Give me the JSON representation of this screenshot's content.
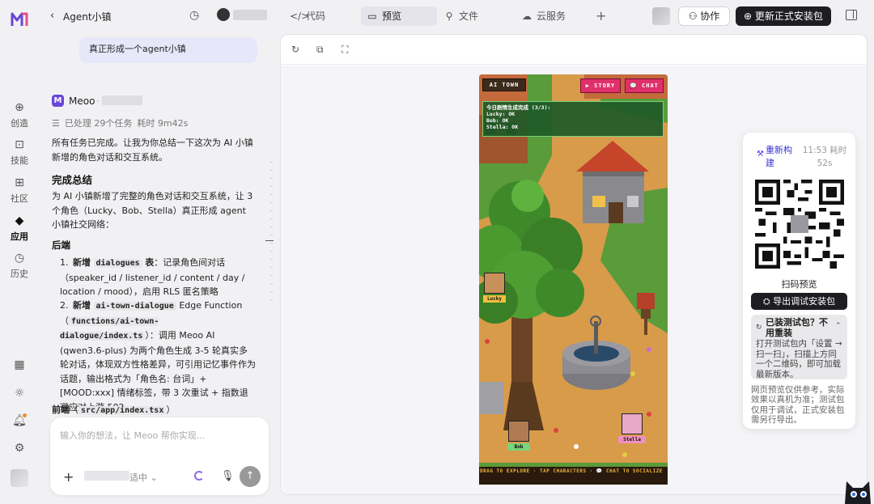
{
  "sidebar": {
    "items": [
      {
        "label": "创造",
        "icon": "plus-circle-icon"
      },
      {
        "label": "技能",
        "icon": "skill-icon"
      },
      {
        "label": "社区",
        "icon": "grid-icon"
      },
      {
        "label": "应用",
        "icon": "cube-icon"
      },
      {
        "label": "历史",
        "icon": "clock-icon"
      }
    ]
  },
  "header": {
    "project_title": "Agent小镇",
    "tabs": [
      {
        "label": "代码",
        "icon": "</>"
      },
      {
        "label": "预览",
        "icon": "▭"
      },
      {
        "label": "文件",
        "icon": "⚲"
      },
      {
        "label": "云服务",
        "icon": "☁"
      }
    ],
    "collab_label": "协作",
    "update_label": "更新正式安装包"
  },
  "chat": {
    "user_message": "真正形成一个agent小镇",
    "assistant_name": "Meoo",
    "task_processed": "已处理 29个任务",
    "task_time": "耗时 9m42s",
    "intro": "所有任务已完成。让我为你总结一下这次为 AI 小镇新增的角色对话和交互系统。",
    "summary_heading": "完成总结",
    "summary_text": "为 AI 小镇新增了完整的角色对话和交互系统，让 3 个角色（Lucky、Bob、Stella）真正形成 agent 小镇社交网络：",
    "backend_heading": "后端",
    "item1_num": "1.",
    "item1_prefix": "新增",
    "item1_code": "dialogues",
    "item1_suffix": "表",
    "item1_desc": "：记录角色间对话（speaker_id / listener_id / content / day / location / mood），启用 RLS 匿名策略",
    "item2_num": "2.",
    "item2_prefix": "新增",
    "item2_code": "ai-town-dialogue",
    "item2_suffix": " Edge Function",
    "item2_path": "functions/ai-town-dialogue/index.ts",
    "item2_desc": "：调用 Meoo AI (qwen3.6-plus) 为两个角色生成 3-5 轮真实多轮对话，体现双方性格差异，可引用记忆事件作为话题，输出格式为「角色名: 台词」+ [MOOD:xxx] 情绪标签，带 3 次重试 + 指数退避应对上游 502",
    "frontend_heading": "前端",
    "frontend_code": "src/app/index.tsx",
    "frontend_suffix": "）"
  },
  "input": {
    "placeholder": "输入你的想法，让 Meoo 帮你实现...",
    "model_suffix": "适中 ⌄"
  },
  "game": {
    "title": "AI TOWN",
    "story_label": "▶ STORY",
    "chat_label": "💬 CHAT",
    "log_lines": [
      "今日剧情生成完成 (3/3):",
      "Lucky: OK",
      "Bob: OK",
      "Stella: OK"
    ],
    "characters": [
      {
        "name": "Lucky"
      },
      {
        "name": "Bob"
      },
      {
        "name": "Stella"
      }
    ],
    "bottom_hint": "DRAG TO EXPLORE · TAP CHARACTERS · 💬 CHAT TO SOCIALIZE"
  },
  "qr_panel": {
    "rebuild_label": "重新构建",
    "rebuild_meta": "11:53 耗时 52s",
    "qr_label": "扫码预览",
    "export_label": "导出调试安装包",
    "installed_title": "已装测试包？不用重装",
    "installed_desc": "打开测试包内「设置 → 扫一扫」，扫描上方同一个二维码，即可加载最新版本。",
    "note": "网页预览仅供参考，实际效果以真机为准；测试包仅用于调试，正式安装包需另行导出。"
  },
  "colors": {
    "accent": "#3a33d0",
    "dark_button": "#1d1d22",
    "game_pink": "#e0306a",
    "game_log": "#1e5a28"
  }
}
